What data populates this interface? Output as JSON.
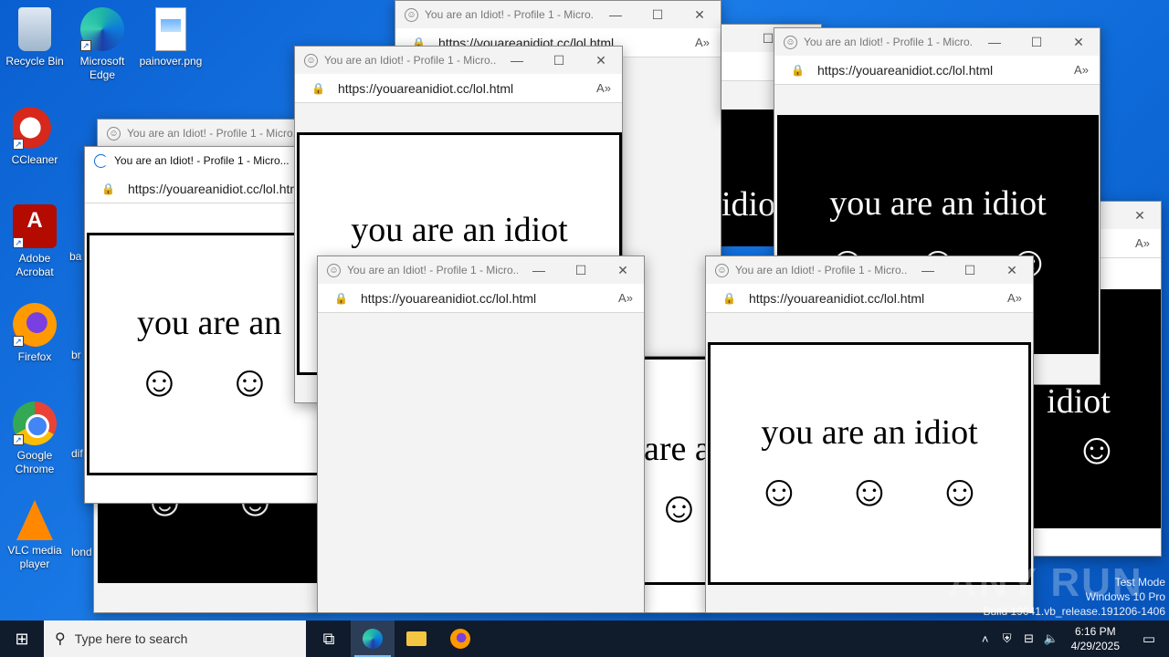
{
  "desktop": {
    "icons": [
      {
        "label": "Recycle Bin",
        "icon": "recycle-bin-icon"
      },
      {
        "label": "Microsoft Edge",
        "icon": "edge-icon"
      },
      {
        "label": "painover.png",
        "icon": "png-file-icon"
      },
      {
        "label": "CCleaner",
        "icon": "ccleaner-icon"
      },
      {
        "label": "Adobe Acrobat",
        "icon": "acrobat-icon"
      },
      {
        "label": "Firefox",
        "icon": "firefox-icon"
      },
      {
        "label": "Google Chrome",
        "icon": "chrome-icon"
      },
      {
        "label": "VLC media player",
        "icon": "vlc-icon"
      }
    ],
    "partial_labels": [
      "ba",
      "br",
      "dif",
      "lond"
    ]
  },
  "windows": {
    "title": "You are an Idiot! - Profile 1 - Micro...",
    "url": "https://youareanidiot.cc/lol.html",
    "message": "you are an idiot",
    "message_partial_1": "you are an",
    "message_partial_2": "idiot",
    "message_partial_3": "are an idiot",
    "message_partial_4": "are a",
    "message_partial_5": "idiot",
    "smiley": "☺",
    "controls": {
      "minimize": "—",
      "maximize": "☐",
      "close": "✕"
    }
  },
  "taskbar": {
    "search_placeholder": "Type here to search",
    "time": "6:16 PM",
    "date": "4/29/2025"
  },
  "watermark": {
    "line1": "Test Mode",
    "line2": "Windows 10 Pro",
    "line3": "Build 19041.vb_release.191206-1406"
  },
  "brand": "ANY RUN"
}
